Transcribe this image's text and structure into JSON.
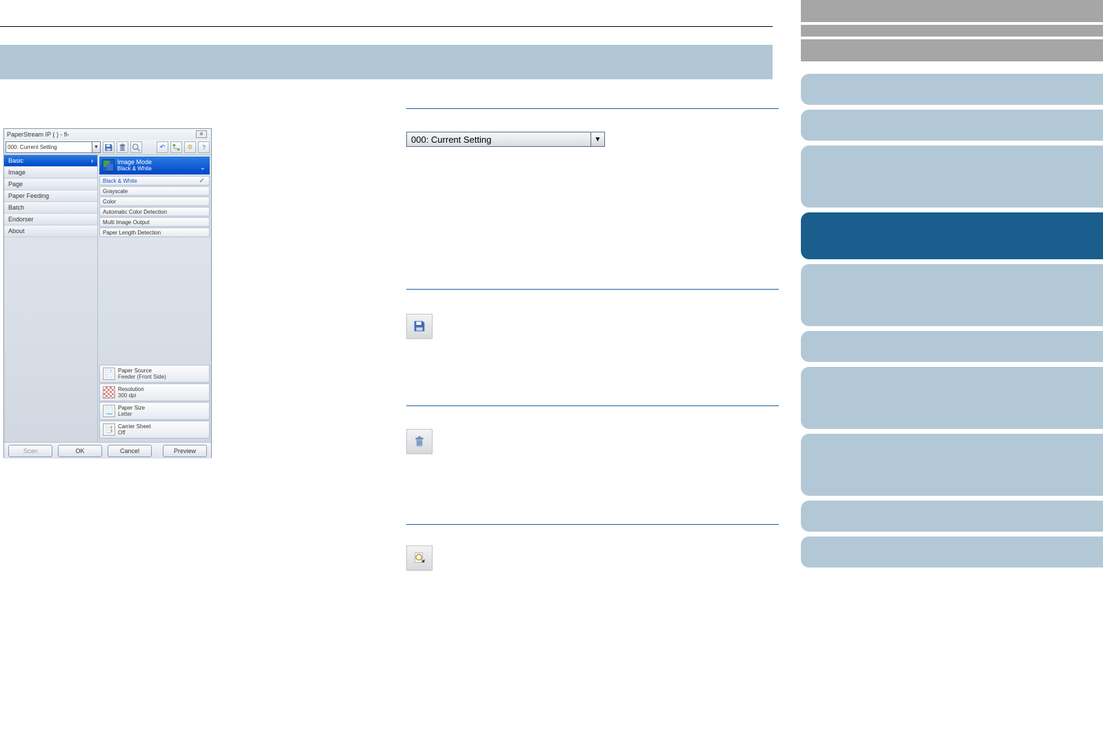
{
  "dialog": {
    "title": "PaperStream IP (          ) - fi-",
    "profile_label": "000: Current Setting",
    "sidebar_items": [
      {
        "label": "Basic",
        "selected": true
      },
      {
        "label": "Image"
      },
      {
        "label": "Page"
      },
      {
        "label": "Paper Feeding"
      },
      {
        "label": "Batch"
      },
      {
        "label": "Endorser"
      },
      {
        "label": "About"
      }
    ],
    "image_mode": {
      "title": "Image Mode",
      "value": "Black & White",
      "options": [
        {
          "label": "Black & White",
          "selected": true
        },
        {
          "label": "Grayscale"
        },
        {
          "label": "Color"
        },
        {
          "label": "Automatic Color Detection"
        },
        {
          "label": "Multi Image Output"
        },
        {
          "label": "Paper Length Detection"
        }
      ]
    },
    "summary": [
      {
        "k": "Paper Source",
        "v": "Feeder (Front Side)"
      },
      {
        "k": "Resolution",
        "v": "300 dpi"
      },
      {
        "k": "Paper Size",
        "v": "Letter"
      },
      {
        "k": "Carrier Sheet",
        "v": "Off"
      }
    ],
    "footer": {
      "scan": "Scan",
      "ok": "OK",
      "cancel": "Cancel",
      "preview": "Preview"
    }
  },
  "main_combo": "000: Current Setting"
}
